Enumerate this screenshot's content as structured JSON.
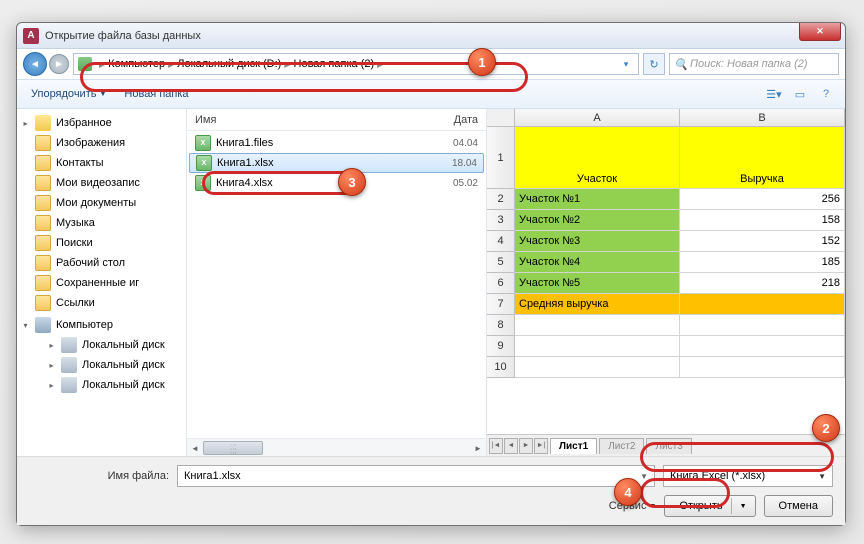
{
  "window": {
    "title": "Открытие файла базы данных"
  },
  "breadcrumb": {
    "computer": "Компьютер",
    "drive": "Локальный диск (D:)",
    "folder": "Новая папка (2)"
  },
  "search": {
    "placeholder": "Поиск: Новая папка (2)"
  },
  "toolbar": {
    "organize": "Упорядочить",
    "newfolder": "Новая папка"
  },
  "sidebar": {
    "fav": "Избранное",
    "items": [
      "Изображения",
      "Контакты",
      "Мои видеозапис",
      "Мои документы",
      "Музыка",
      "Поиски",
      "Рабочий стол",
      "Сохраненные иг",
      "Ссылки"
    ],
    "computer": "Компьютер",
    "drives": [
      "Локальный диск",
      "Локальный диск",
      "Локальный диск"
    ]
  },
  "filelist": {
    "colName": "Имя",
    "colDate": "Дата",
    "rows": [
      {
        "name": "Книга1.files",
        "date": "04.04"
      },
      {
        "name": "Книга1.xlsx",
        "date": "18.04"
      },
      {
        "name": "Книга4.xlsx",
        "date": "05.02"
      }
    ]
  },
  "preview": {
    "colA": "A",
    "colB": "B",
    "hdr": {
      "a": "Участок",
      "b": "Выручка"
    },
    "rows": [
      {
        "a": "Участок №1",
        "b": "256"
      },
      {
        "a": "Участок №2",
        "b": "158"
      },
      {
        "a": "Участок №3",
        "b": "152"
      },
      {
        "a": "Участок №4",
        "b": "185"
      },
      {
        "a": "Участок №5",
        "b": "218"
      }
    ],
    "avg": "Средняя выручка",
    "tabs": [
      "Лист1",
      "Лист2",
      "Лист3"
    ]
  },
  "bottom": {
    "fnLabel": "Имя файла:",
    "fnValue": "Книга1.xlsx",
    "typeValue": "Книга Excel (*.xlsx)",
    "service": "Сервис",
    "open": "Открыть",
    "cancel": "Отмена"
  },
  "markers": {
    "1": "1",
    "2": "2",
    "3": "3",
    "4": "4"
  }
}
